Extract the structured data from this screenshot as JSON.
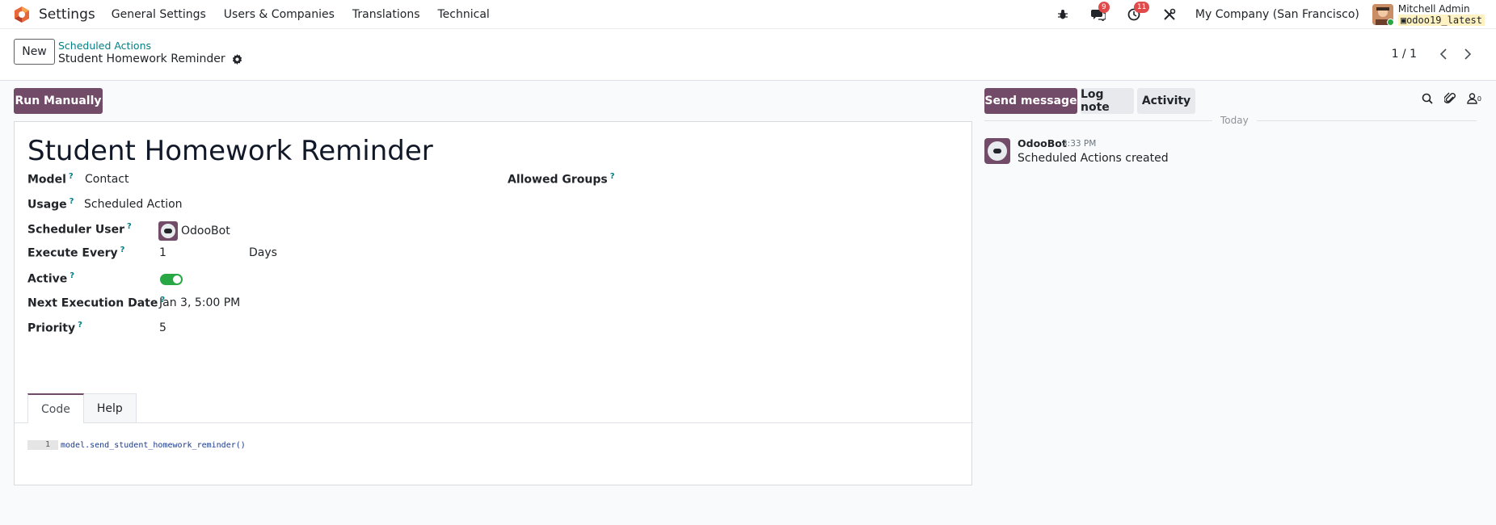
{
  "navbar": {
    "app_name": "Settings",
    "menu": [
      "General Settings",
      "Users & Companies",
      "Translations",
      "Technical"
    ],
    "messages_count": "9",
    "activities_count": "11",
    "company": "My Company (San Francisco)",
    "user_name": "Mitchell Admin",
    "database": "odoo19_latest"
  },
  "control": {
    "new_label": "New",
    "breadcrumb_parent": "Scheduled Actions",
    "breadcrumb_current": "Student Homework Reminder",
    "pager_value": "1 / 1"
  },
  "form": {
    "run_label": "Run Manually",
    "title": "Student Homework Reminder",
    "fields": {
      "model_label": "Model",
      "model_value": "Contact",
      "usage_label": "Usage",
      "usage_value": "Scheduled Action",
      "scheduler_user_label": "Scheduler User",
      "scheduler_user_value": "OdooBot",
      "execute_every_label": "Execute Every",
      "execute_every_value": "1",
      "execute_every_unit": "Days",
      "active_label": "Active",
      "active_value": true,
      "next_execution_label": "Next Execution Date",
      "next_execution_value": "Jan 3, 5:00 PM",
      "priority_label": "Priority",
      "priority_value": "5",
      "allowed_groups_label": "Allowed Groups",
      "help_marker": "?"
    },
    "tabs": [
      "Code",
      "Help"
    ],
    "active_tab": "Code",
    "code": {
      "line_number": "1",
      "text": "model.send_student_homework_reminder()"
    }
  },
  "chatter": {
    "send_message_label": "Send message",
    "log_note_label": "Log note",
    "activity_label": "Activity",
    "followers_count": "0",
    "separator_label": "Today",
    "messages": [
      {
        "author": "OdooBot",
        "time": "3:33 PM",
        "body": "Scheduled Actions created"
      }
    ]
  },
  "colors": {
    "brand": "#714b67",
    "link": "#017e84",
    "toggle_on": "#28a745",
    "badge": "#e04a4a"
  }
}
